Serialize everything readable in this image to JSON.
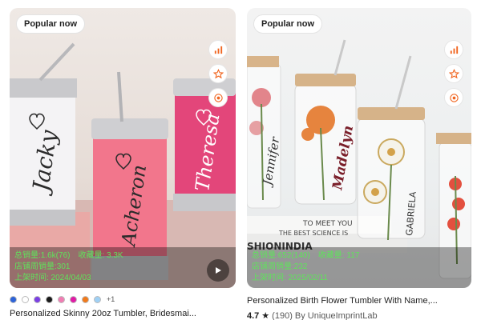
{
  "products": [
    {
      "badge": "Popular now",
      "stats": {
        "line1_a": "总销量:1.6k(76)",
        "line1_b": "收藏量: 3.3K",
        "line2": "店铺周销量:301",
        "line3": "上架时间: 2024/04/03"
      },
      "variant_colors": [
        "#2d63d8",
        "#ffffff",
        "#7b3fe4",
        "#1a1a1a",
        "#f07db3",
        "#e01ba6",
        "#f07a1c",
        "#9fd0f5"
      ],
      "variants_more": "+1",
      "title": "Personalized Skinny 20oz Tumbler, Bridesmai...",
      "cup_names": [
        "Jacky",
        "Acheron",
        "Theresa"
      ]
    },
    {
      "badge": "Popular now",
      "stats": {
        "line1_a": "总销量:652(140)",
        "line1_b": "收藏量: 117",
        "line2": "店铺周销量:232",
        "line3": "上架时间: 2025/02/11"
      },
      "title": "Personalized Birth Flower Tumbler With Name,...",
      "rating": "4.7",
      "review_count": "(190)",
      "shop": "By UniqueImprintLab",
      "glass_names": [
        "Jennifer",
        "Madelyn",
        "GABRIELA"
      ],
      "book_text_1": "TO MEET YOU",
      "book_text_2": "THE BEST SCIENCE IS",
      "book_text_3": "SHIONINDIA"
    }
  ],
  "colors": {
    "stat_green": "#5fe35b",
    "etsy_orange": "#f1641e"
  },
  "icons": [
    "analytics-icon",
    "star-outline-icon",
    "target-icon",
    "play-icon"
  ]
}
